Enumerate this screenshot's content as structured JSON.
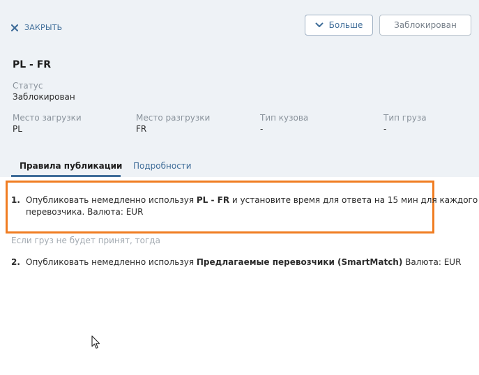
{
  "header": {
    "close_label": "ЗАКРЫТЬ",
    "more_label": "Больше",
    "blocked_label": "Заблокирован",
    "route_title": "PL - FR"
  },
  "status": {
    "label": "Статус",
    "value": "Заблокирован"
  },
  "fields": [
    {
      "label": "Место загрузки",
      "value": "PL"
    },
    {
      "label": "Место разгрузки",
      "value": "FR"
    },
    {
      "label": "Тип кузова",
      "value": "-"
    },
    {
      "label": "Тип груза",
      "value": "-"
    }
  ],
  "tabs": [
    {
      "label": "Правила публикации",
      "active": true
    },
    {
      "label": "Подробности",
      "active": false
    }
  ],
  "rules": [
    {
      "number": "1.",
      "prefix": "Опубликовать немедленно используя ",
      "bold": "PL - FR",
      "suffix_line1": " и установите время для ответа на 15 мин для каждого",
      "line2": "перевозчика. Валюта: EUR"
    },
    {
      "number": "2.",
      "prefix": "Опубликовать немедленно используя ",
      "bold": "Предлагаемые перевозчики (SmartMatch)",
      "suffix": " Валюта: EUR"
    }
  ],
  "fallback_text": "Если груз не будет принят, тогда",
  "colors": {
    "accent": "#3f6d99",
    "highlight": "#f07d22",
    "panel_bg": "#eef2f6"
  },
  "icons": {
    "close": "close-icon",
    "more": "chevron-down-icon",
    "cursor": "mouse-cursor-icon"
  }
}
